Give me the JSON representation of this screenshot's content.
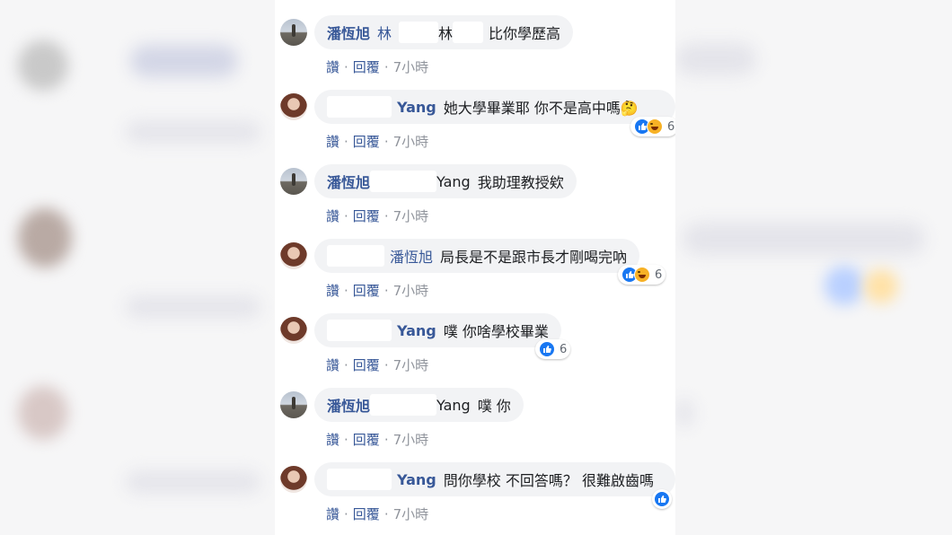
{
  "actions": {
    "like": "讚",
    "reply": "回覆",
    "time": "7小時",
    "sep": "·"
  },
  "comments": [
    {
      "name": "潘恆旭",
      "tag1": "林",
      "tag2": "林",
      "text": "比你學歷高"
    },
    {
      "name": "Yang",
      "text": "她大學畢業耶 你不是高中嗎🤔",
      "reaction_count": "6"
    },
    {
      "name": "潘恆旭",
      "tag_text": "Yang",
      "text": "我助理教授欸"
    },
    {
      "tag": "潘恆旭",
      "text": "局長是不是跟市長才剛喝完吶",
      "reaction_count": "6"
    },
    {
      "name": "Yang",
      "text": "噗 你啥學校畢業",
      "reaction_count": "6"
    },
    {
      "name": "潘恆旭",
      "tag_text": "Yang",
      "text": "噗 你"
    },
    {
      "name": "Yang",
      "text": "問你學校 不回答嗎？ 很難啟齒嗎"
    }
  ],
  "colors": {
    "name": "#385898",
    "bubble": "#f2f3f5",
    "like": "#1877f2",
    "haha": "#f7b125",
    "meta": "#90949c"
  },
  "icons": {
    "like": "thumbs-up-icon",
    "haha": "laughing-face-icon"
  }
}
